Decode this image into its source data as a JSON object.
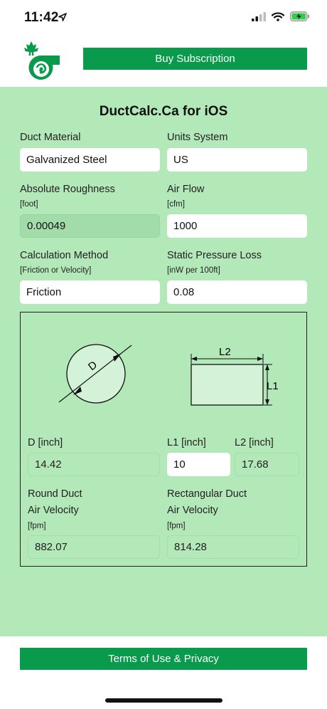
{
  "status": {
    "time": "11:42"
  },
  "header": {
    "buy_label": "Buy Subscription"
  },
  "app": {
    "title": "DuctCalc.Ca for iOS"
  },
  "form": {
    "duct_material": {
      "label": "Duct Material",
      "value": "Galvanized Steel"
    },
    "units_system": {
      "label": "Units System",
      "value": "US"
    },
    "roughness": {
      "label": "Absolute Roughness",
      "unit": "[foot]",
      "value": "0.00049"
    },
    "air_flow": {
      "label": "Air Flow",
      "unit": "[cfm]",
      "value": "1000"
    },
    "calc_method": {
      "label": "Calculation Method",
      "unit": "[Friction or Velocity]",
      "value": "Friction"
    },
    "pressure_loss": {
      "label": "Static Pressure Loss",
      "unit": "[inW per 100ft]",
      "value": "0.08"
    }
  },
  "diagram": {
    "circle_label": "D",
    "rect_width_label": "L2",
    "rect_height_label": "L1"
  },
  "results": {
    "d": {
      "label": "D [inch]",
      "value": "14.42"
    },
    "l1": {
      "label": "L1 [inch]",
      "value": "10"
    },
    "l2": {
      "label": "L2 [inch]",
      "value": "17.68"
    },
    "round_velocity": {
      "label1": "Round Duct",
      "label2": "Air Velocity",
      "unit": "[fpm]",
      "value": "882.07"
    },
    "rect_velocity": {
      "label1": "Rectangular Duct",
      "label2": "Air Velocity",
      "unit": "[fpm]",
      "value": "814.28"
    }
  },
  "footer": {
    "terms_label": "Terms of Use & Privacy"
  },
  "colors": {
    "brand_green": "#0a9a4b",
    "panel_green": "#b3e8b9",
    "readonly_green": "#a3dcab"
  }
}
